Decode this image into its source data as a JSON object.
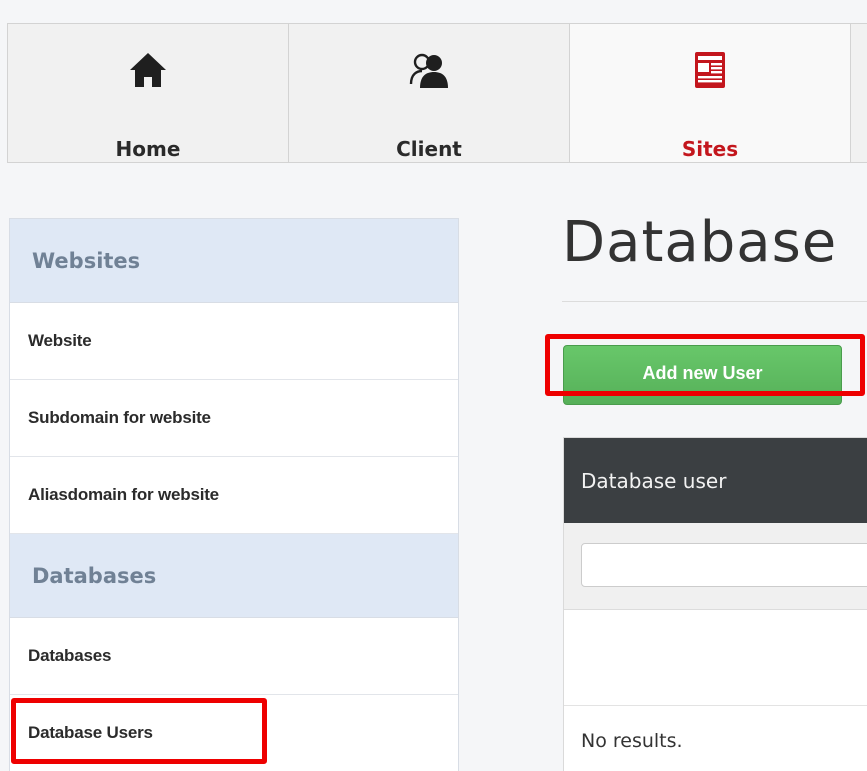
{
  "nav": {
    "tabs": [
      {
        "label": "Home",
        "icon": "home-icon",
        "active": false
      },
      {
        "label": "Client",
        "icon": "users-icon",
        "active": false
      },
      {
        "label": "Sites",
        "icon": "sites-icon",
        "active": true
      }
    ]
  },
  "sidebar": {
    "sections": [
      {
        "header": "Websites",
        "items": [
          "Website",
          "Subdomain for website",
          "Aliasdomain for website"
        ]
      },
      {
        "header": "Databases",
        "items": [
          "Databases",
          "Database Users"
        ]
      }
    ]
  },
  "main": {
    "title": "Database",
    "add_button": "Add new User",
    "table": {
      "column_header": "Database user",
      "filter_placeholder": "",
      "no_results": "No results."
    }
  },
  "colors": {
    "accent": "#c3161d",
    "highlight": "#ee0000",
    "button_green": "#5cb85c",
    "table_header": "#3b3f42",
    "sidebar_header_bg": "#dfe8f5"
  }
}
